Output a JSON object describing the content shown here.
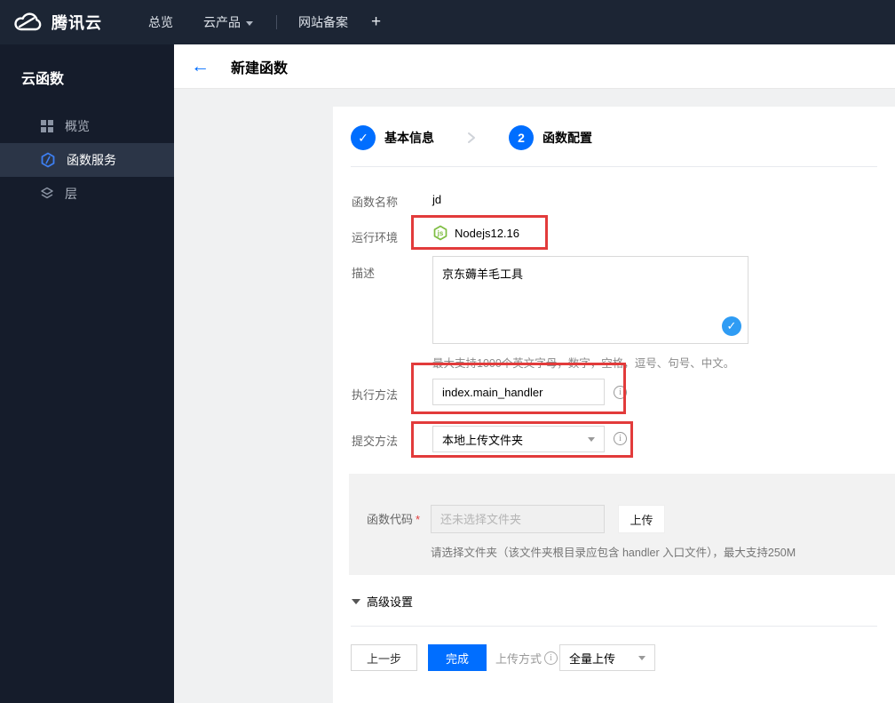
{
  "navbar": {
    "brand": "腾讯云",
    "overview": "总览",
    "products": "云产品",
    "beian": "网站备案",
    "plus": "+"
  },
  "sidebar": {
    "title": "云函数",
    "items": [
      {
        "label": "概览",
        "icon": "grid-icon",
        "active": false
      },
      {
        "label": "函数服务",
        "icon": "function-hexagon-icon",
        "active": true
      },
      {
        "label": "层",
        "icon": "layers-icon",
        "active": false
      }
    ]
  },
  "header": {
    "title": "新建函数"
  },
  "steps": [
    {
      "num": "✓",
      "label": "基本信息",
      "state": "done"
    },
    {
      "num": "2",
      "label": "函数配置",
      "state": "current"
    }
  ],
  "form": {
    "function_name": {
      "label": "函数名称",
      "value": "jd"
    },
    "runtime": {
      "label": "运行环境",
      "value": "Nodejs12.16",
      "icon": "nodejs-icon"
    },
    "description": {
      "label": "描述",
      "value": "京东薅羊毛工具",
      "hint": "最大支持1000个英文字母，数字，空格，逗号、句号、中文。"
    },
    "handler": {
      "label": "执行方法",
      "value": "index.main_handler"
    },
    "submit_method": {
      "label": "提交方法",
      "value": "本地上传文件夹"
    },
    "function_code": {
      "label": "函数代码",
      "required_mark": "*",
      "placeholder": "还未选择文件夹",
      "upload_button": "上传",
      "hint": "请选择文件夹（该文件夹根目录应包含 handler 入口文件），最大支持250M"
    },
    "advanced": {
      "label": "高级设置"
    }
  },
  "footer": {
    "prev_button": "上一步",
    "finish_button": "完成",
    "upload_mode_label": "上传方式",
    "upload_mode_value": "全量上传"
  },
  "colors": {
    "accent_blue": "#006eff",
    "badge_blue": "#2f9cf4",
    "annotation_red": "#e23b3b",
    "node_green": "#7ebd42",
    "navbar_bg": "#1c2534",
    "sidebar_bg": "#151c2b"
  }
}
